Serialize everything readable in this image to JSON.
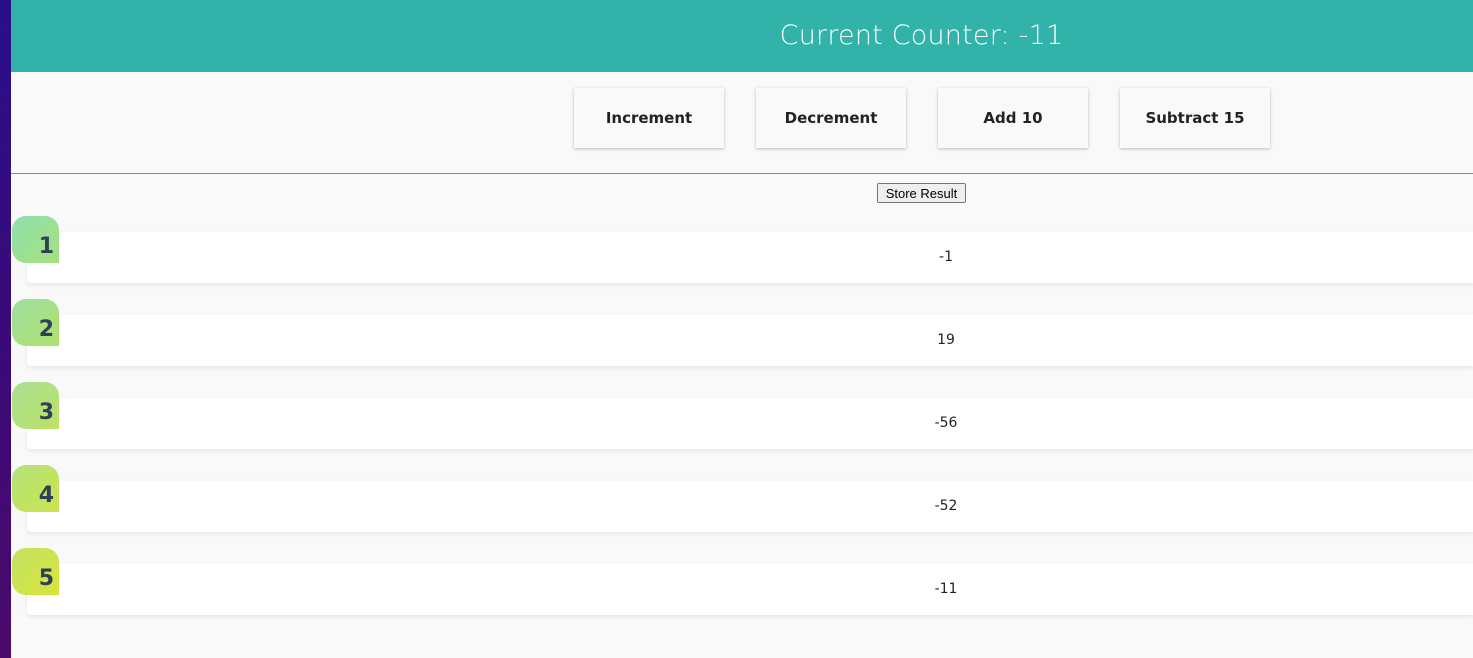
{
  "header": {
    "title": "Current Counter: -11"
  },
  "controls": {
    "increment_label": "Increment",
    "decrement_label": "Decrement",
    "add_label": "Add 10",
    "subtract_label": "Subtract 15"
  },
  "store": {
    "label": "Store Result"
  },
  "results": [
    {
      "index": "1",
      "value": "-1"
    },
    {
      "index": "2",
      "value": "19"
    },
    {
      "index": "3",
      "value": "-56"
    },
    {
      "index": "4",
      "value": "-52"
    },
    {
      "index": "5",
      "value": "-11"
    }
  ],
  "colors": {
    "header_bg": "#31b3a9",
    "badge_start": "#8ee0a8",
    "badge_end": "#d6e43c",
    "badge_text": "#2e3f56"
  }
}
